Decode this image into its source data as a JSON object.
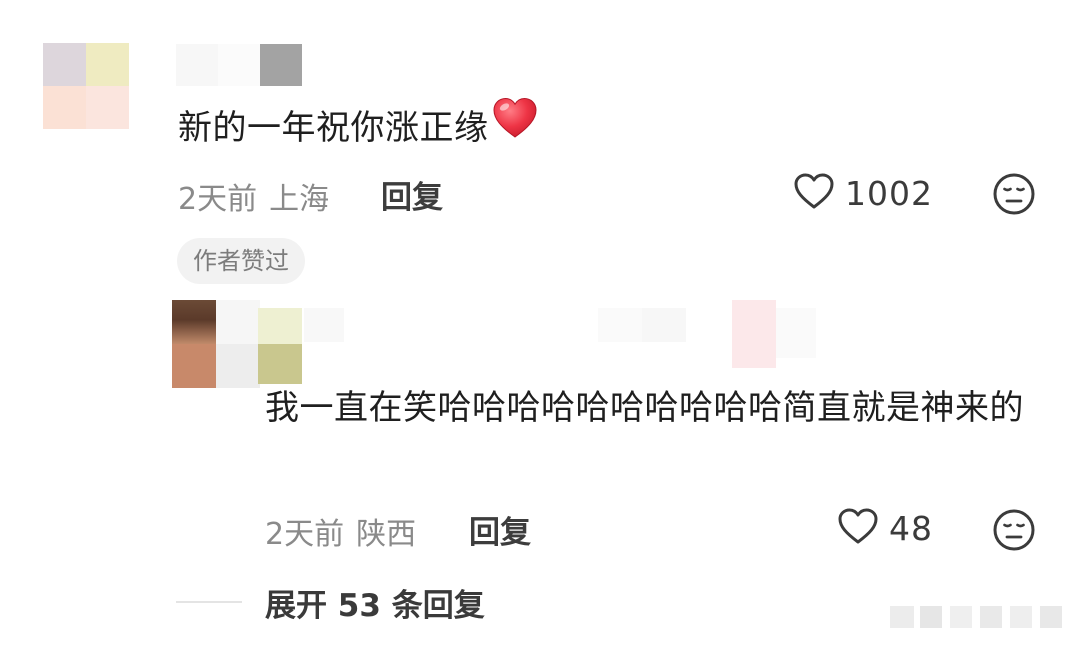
{
  "comments": [
    {
      "text": "新的一年祝你涨正缘",
      "emoji": "red-heart",
      "time": "2天前",
      "location": "上海",
      "reply_label": "回复",
      "likes": "1002",
      "badge": "作者赞过"
    },
    {
      "text": "我一直在笑哈哈哈哈哈哈哈哈哈哈简直就是神来的",
      "time": "2天前",
      "location": "陕西",
      "reply_label": "回复",
      "likes": "48"
    }
  ],
  "expand_replies": "展开 53 条回复",
  "icons": {
    "like": "heart-outline-icon",
    "dislike": "neutral-face-icon"
  },
  "colors": {
    "text_primary": "#1f1f1f",
    "text_meta": "#8a8a8a",
    "heart_red": "#e8303f",
    "badge_bg": "#f2f2f2"
  }
}
